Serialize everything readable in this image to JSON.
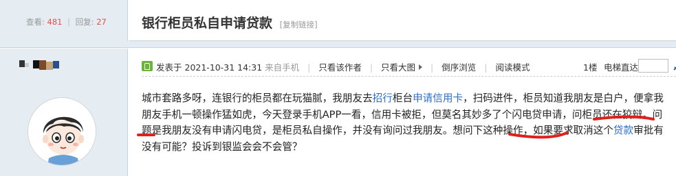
{
  "header": {
    "views_label": "查看:",
    "views_value": "481",
    "sep": "|",
    "replies_label": "回复:",
    "replies_value": "27",
    "title": "银行柜员私自申请贷款",
    "copy_link": "[复制链接]"
  },
  "post": {
    "author_pixels": [
      "#333333",
      "#cccccc",
      "#111111",
      "#7a4a2a",
      "#c8a27a",
      "#2a4e8c"
    ],
    "meta": {
      "posted_prefix": "发表于",
      "datetime": "2021-10-31 14:31",
      "source": "来自手机",
      "only_author": "只看该作者",
      "large_image": "只看大图",
      "reverse_order": "倒序浏览",
      "reading_mode": "阅读模式",
      "floor": "1楼",
      "jump_label": "电梯直达"
    },
    "body": {
      "s1": "城市套路多呀，连银行的柜员都在玩猫腻，我朋友去",
      "link1": "招行",
      "s2": "柜台",
      "link2": "申请信用卡",
      "s3": "，扫码进件，柜员知道我朋友是白户，便拿我朋友手机一顿操作猛如虎，今天登录手机APP一看，信用卡被拒，但莫名其妙多了个闪电贷申请，问柜员还在狡辩。问题是我朋友没有申请闪电贷，是柜员私自操作，并没有询问过我朋友。想问下这种操作，如果要求取消这个",
      "link3": "贷款",
      "s4": "审批有没有可能？投诉到银监会会不会管？"
    }
  },
  "colors": {
    "accent_red": "#d9534f",
    "link_blue": "#2a6fc9",
    "sidebar_bg": "#e5edf2",
    "annotation_red": "#e0201b"
  },
  "icons": {
    "online": "online-phone-icon",
    "jump": "jump-arrow-icon"
  }
}
